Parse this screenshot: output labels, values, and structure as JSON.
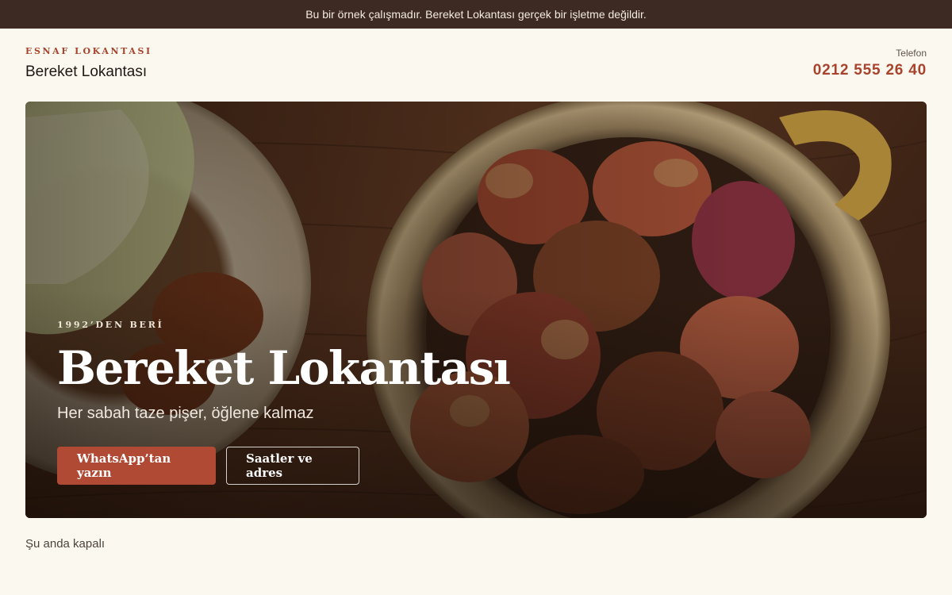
{
  "notice": "Bu bir örnek çalışmadır. Bereket Lokantası gerçek bir işletme değildir.",
  "header": {
    "eyebrow": "ESNAF LOKANTASI",
    "name": "Bereket Lokantası",
    "phone_label": "Telefon",
    "phone_number": "0212 555 26 40"
  },
  "hero": {
    "eyebrow": "1992’DEN BERİ",
    "title": "Bereket Lokantası",
    "subtitle": "Her sabah taze pişer, öğlene kalmaz",
    "primary_button": "WhatsApp’tan yazın",
    "secondary_button": "Saatler ve adres"
  },
  "status": "Şu anda kapalı",
  "colors": {
    "accent": "#a8432d",
    "notice_bg": "#3d2a22",
    "page_bg": "#fbf8ef"
  }
}
